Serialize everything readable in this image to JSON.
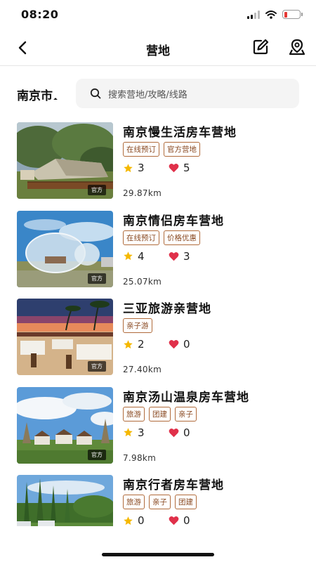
{
  "status_bar": {
    "time": "08:20"
  },
  "nav": {
    "title": "营地"
  },
  "city": {
    "label": "南京市"
  },
  "search": {
    "placeholder": "搜索营地/攻略/线路"
  },
  "official_label": "官方",
  "camps": [
    {
      "name": "南京慢生活房车营地",
      "tags": [
        "在线预订",
        "官方营地"
      ],
      "rating": "3",
      "likes": "5",
      "distance": "29.87km",
      "official": true
    },
    {
      "name": "南京情侣房车营地",
      "tags": [
        "在线预订",
        "价格优惠"
      ],
      "rating": "4",
      "likes": "3",
      "distance": "25.07km",
      "official": true
    },
    {
      "name": "三亚旅游亲营地",
      "tags": [
        "亲子游"
      ],
      "rating": "2",
      "likes": "0",
      "distance": "27.40km",
      "official": true
    },
    {
      "name": "南京汤山温泉房车营地",
      "tags": [
        "旅游",
        "团建",
        "亲子"
      ],
      "rating": "3",
      "likes": "0",
      "distance": "7.98km",
      "official": true
    },
    {
      "name": "南京行者房车营地",
      "tags": [
        "旅游",
        "亲子",
        "团建"
      ],
      "rating": "0",
      "likes": "0",
      "distance": "",
      "official": false
    }
  ],
  "colors": {
    "star": "#f5b800",
    "heart": "#e0304a",
    "tag_border": "#b06a3a",
    "battery_low": "#e53935"
  }
}
